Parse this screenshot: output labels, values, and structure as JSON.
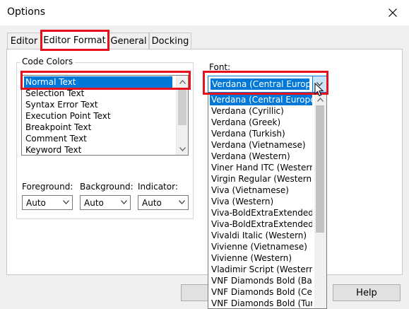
{
  "window": {
    "title": "Options"
  },
  "tabs": [
    {
      "label": "Editor"
    },
    {
      "label": "Editor Format"
    },
    {
      "label": "General"
    },
    {
      "label": "Docking"
    }
  ],
  "code_colors": {
    "label": "Code Colors",
    "items": [
      "Normal Text",
      "Selection Text",
      "Syntax Error Text",
      "Execution Point Text",
      "Breakpoint Text",
      "Comment Text",
      "Keyword Text"
    ],
    "selected_index": 0
  },
  "color_pickers": {
    "foreground": {
      "label": "Foreground:",
      "value": "Auto"
    },
    "background": {
      "label": "Background:",
      "value": "Auto"
    },
    "indicator": {
      "label": "Indicator:",
      "value": "Auto"
    }
  },
  "font": {
    "label": "Font:",
    "value": "Verdana (Central Europ",
    "options": [
      "Verdana (Central Europe",
      "Verdana (Cyrillic)",
      "Verdana (Greek)",
      "Verdana (Turkish)",
      "Verdana (Vietnamese)",
      "Verdana (Western)",
      "Viner Hand ITC (Western",
      "Virgin Regular (Western)",
      "Viva (Vietnamese)",
      "Viva (Western)",
      "Viva-BoldExtraExtended (",
      "Viva-BoldExtraExtended (",
      "Vivaldi Italic (Western)",
      "Vivienne (Vietnamese)",
      "Vivienne (Western)",
      "Vladimir Script (Western",
      "VNF Diamonds Bold (Balt",
      "VNF Diamonds Bold (Cen",
      "VNF Diamonds Bold (Tur"
    ]
  },
  "buttons": {
    "help": "Help"
  },
  "colors": {
    "highlight": "#e8101b",
    "selection": "#0078d7"
  }
}
